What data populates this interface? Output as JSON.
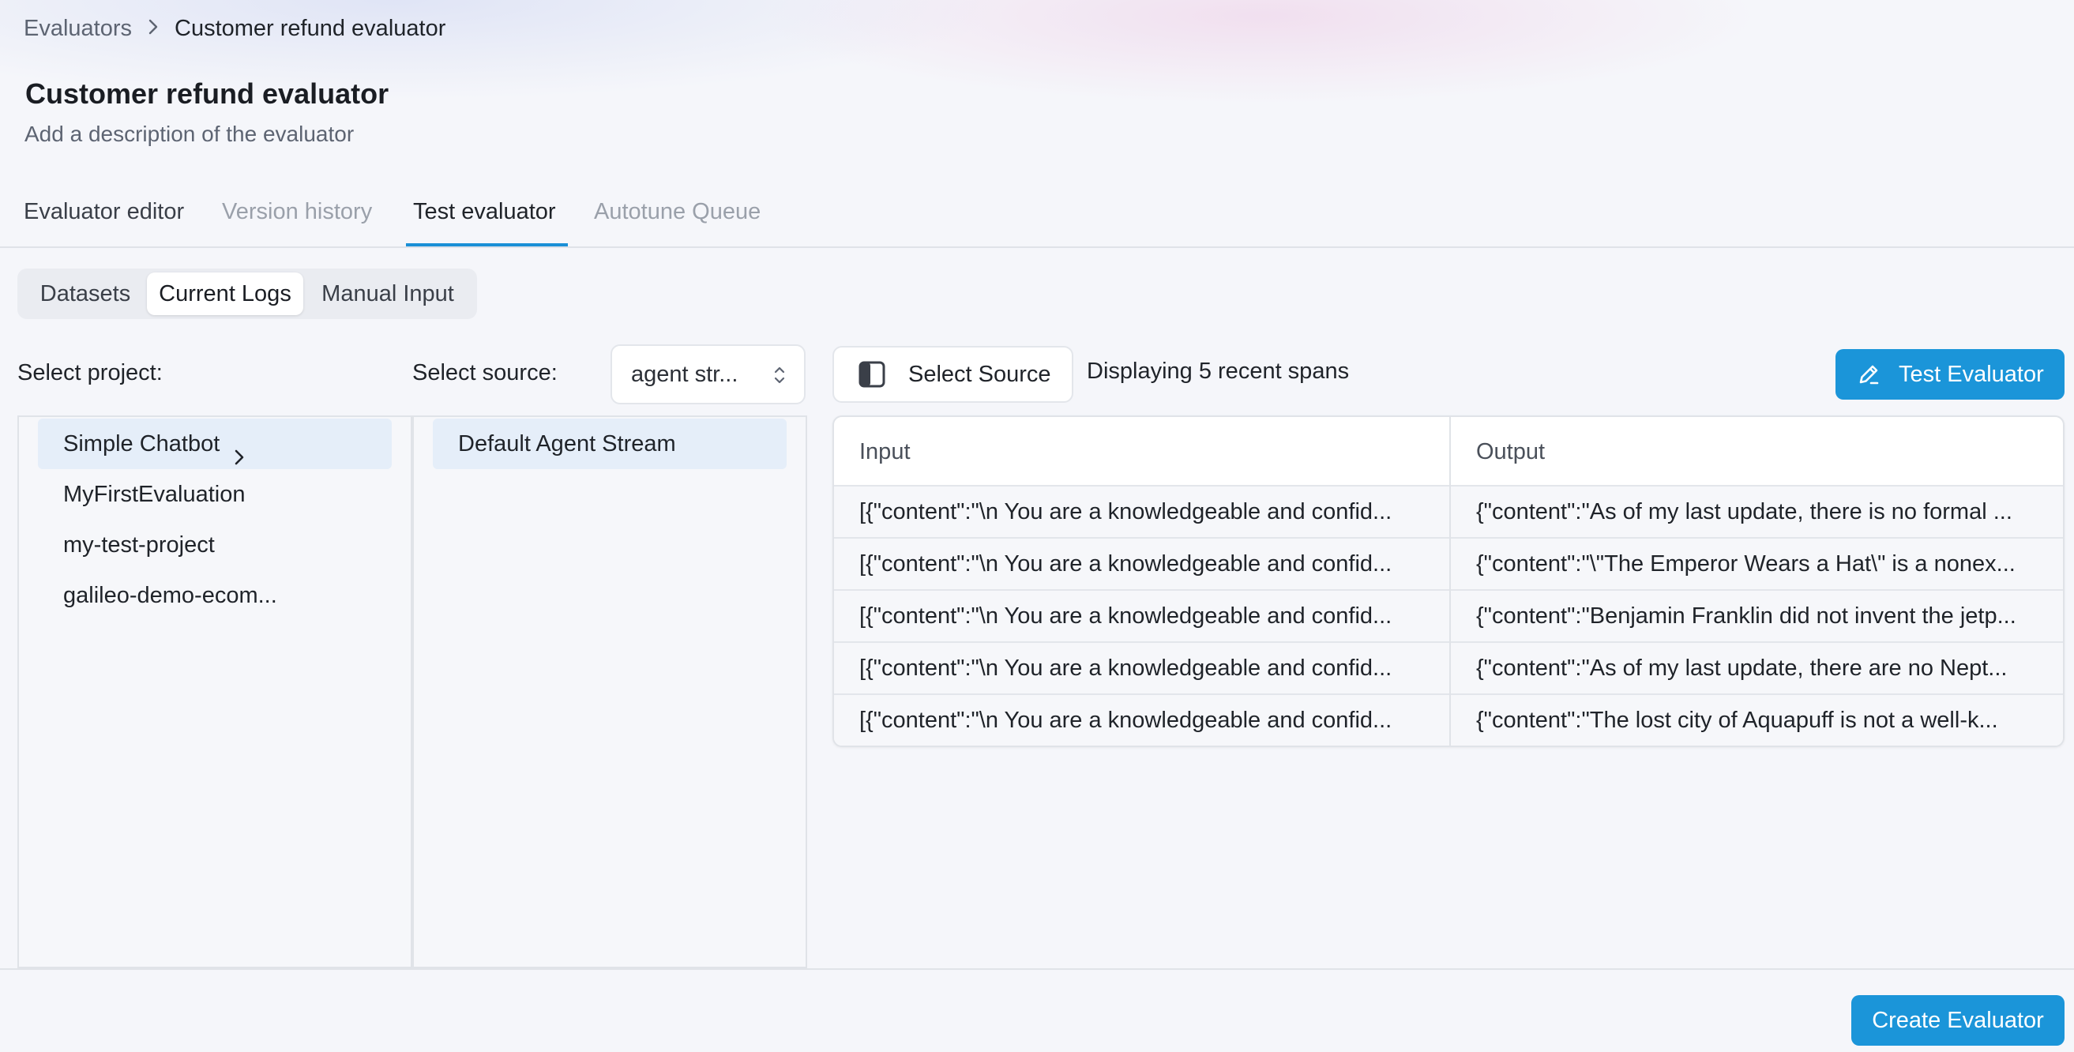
{
  "breadcrumb": {
    "root": "Evaluators",
    "current": "Customer refund evaluator"
  },
  "header": {
    "title": "Customer refund evaluator",
    "description": "Add a description of the evaluator"
  },
  "tabs": [
    "Evaluator editor",
    "Version history",
    "Test evaluator",
    "Autotune Queue"
  ],
  "subtabs": [
    "Datasets",
    "Current Logs",
    "Manual Input"
  ],
  "project": {
    "label": "Select project:",
    "items": [
      "Simple Chatbot",
      "MyFirstEvaluation",
      "my-test-project",
      "galileo-demo-ecom..."
    ]
  },
  "source": {
    "label": "Select source:",
    "selected": "agent str...",
    "items": [
      "Default Agent Stream"
    ]
  },
  "toolbar": {
    "select_source_label": "Select Source",
    "displaying_text": "Displaying 5 recent spans",
    "test_label": "Test Evaluator"
  },
  "table": {
    "headers": [
      "Input",
      "Output"
    ],
    "rows": [
      [
        "[{\"content\":\"\\n You are a knowledgeable and confid...",
        "{\"content\":\"As of my last update, there is no formal ..."
      ],
      [
        "[{\"content\":\"\\n You are a knowledgeable and confid...",
        "{\"content\":\"\\\"The Emperor Wears a Hat\\\" is a nonex..."
      ],
      [
        "[{\"content\":\"\\n You are a knowledgeable and confid...",
        "{\"content\":\"Benjamin Franklin did not invent the jetp..."
      ],
      [
        "[{\"content\":\"\\n You are a knowledgeable and confid...",
        "{\"content\":\"As of my last update, there are no Nept..."
      ],
      [
        "[{\"content\":\"\\n You are a knowledgeable and confid...",
        "{\"content\":\"The lost city of Aquapuff is not a well-k..."
      ]
    ]
  },
  "footer": {
    "create_label": "Create Evaluator"
  },
  "colors": {
    "accent": "#1b95d9",
    "selected_row": "#e5eef9"
  },
  "icons": [
    "chevron-right-icon",
    "sort-chevrons-icon",
    "sidebar-panel-icon",
    "pencil-icon"
  ]
}
